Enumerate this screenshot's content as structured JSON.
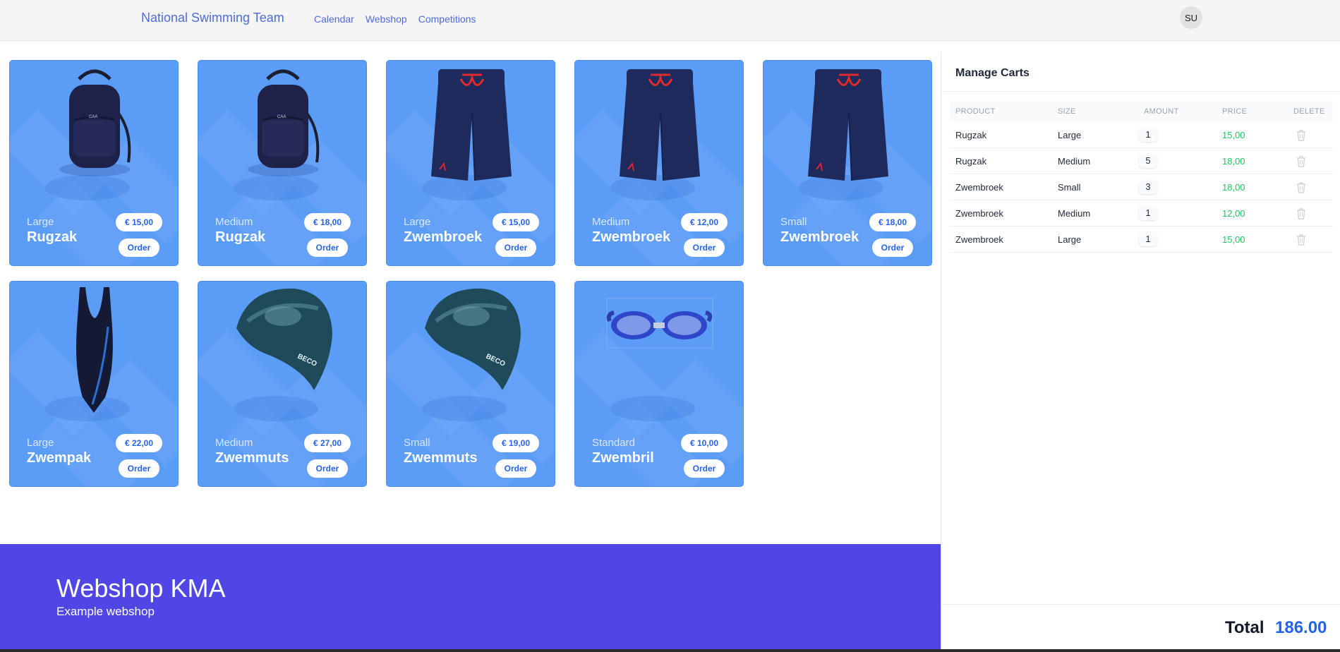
{
  "topbar": {
    "brand": "National Swimming Team",
    "nav": [
      "Calendar",
      "Webshop",
      "Competitions"
    ],
    "avatar": "SU"
  },
  "products": [
    {
      "size": "Large",
      "name": "Rugzak",
      "price": "€ 15,00",
      "order": "Order",
      "icon": "backpack-image"
    },
    {
      "size": "Medium",
      "name": "Rugzak",
      "price": "€ 18,00",
      "order": "Order",
      "icon": "backpack-image"
    },
    {
      "size": "Large",
      "name": "Zwembroek",
      "price": "€ 15,00",
      "order": "Order",
      "icon": "swim-shorts-image"
    },
    {
      "size": "Medium",
      "name": "Zwembroek",
      "price": "€ 12,00",
      "order": "Order",
      "icon": "swim-shorts-image"
    },
    {
      "size": "Small",
      "name": "Zwembroek",
      "price": "€ 18,00",
      "order": "Order",
      "icon": "swim-shorts-image"
    },
    {
      "size": "Large",
      "name": "Zwempak",
      "price": "€ 22,00",
      "order": "Order",
      "icon": "swimsuit-image"
    },
    {
      "size": "Medium",
      "name": "Zwemmuts",
      "price": "€ 27,00",
      "order": "Order",
      "icon": "swim-cap-image"
    },
    {
      "size": "Small",
      "name": "Zwemmuts",
      "price": "€ 19,00",
      "order": "Order",
      "icon": "swim-cap-image"
    },
    {
      "size": "Standard",
      "name": "Zwembril",
      "price": "€ 10,00",
      "order": "Order",
      "icon": "goggles-image"
    }
  ],
  "cart": {
    "title": "Manage Carts",
    "headers": [
      "PRODUCT",
      "SIZE",
      "AMOUNT",
      "PRICE",
      "DELETE"
    ],
    "rows": [
      {
        "product": "Rugzak",
        "size": "Large",
        "amount": "1",
        "price": "15,00"
      },
      {
        "product": "Rugzak",
        "size": "Medium",
        "amount": "5",
        "price": "18,00"
      },
      {
        "product": "Zwembroek",
        "size": "Small",
        "amount": "3",
        "price": "18,00"
      },
      {
        "product": "Zwembroek",
        "size": "Medium",
        "amount": "1",
        "price": "12,00"
      },
      {
        "product": "Zwembroek",
        "size": "Large",
        "amount": "1",
        "price": "15,00"
      }
    ],
    "total_label": "Total",
    "total_value": "186.00"
  },
  "footer": {
    "title": "Webshop KMA",
    "subtitle": "Example webshop"
  },
  "colors": {
    "card": "#5b9cf6",
    "accent": "#2563eb",
    "footer": "#4f46e5",
    "price_green": "#22c55e"
  }
}
